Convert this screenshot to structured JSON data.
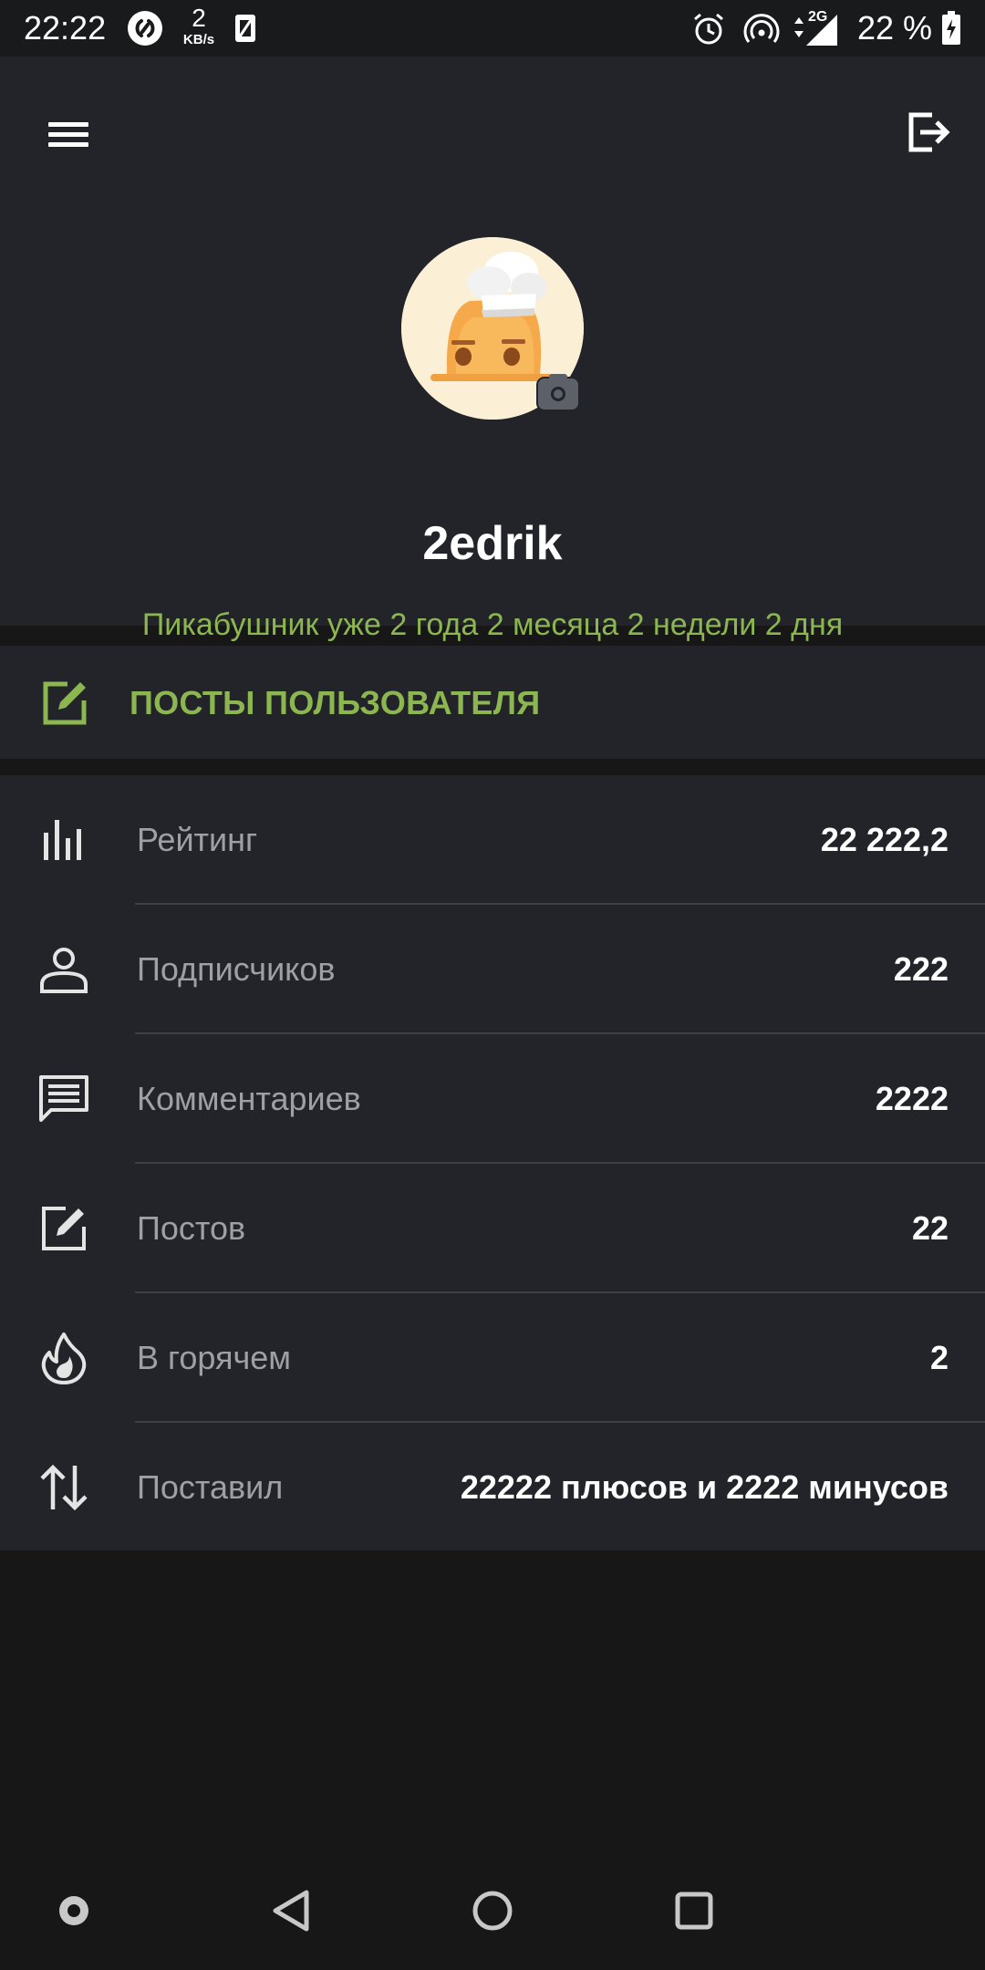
{
  "status_bar": {
    "time": "22:22",
    "speed_value": "2",
    "speed_unit": "KB/s",
    "network": "2G",
    "battery": "22 %"
  },
  "profile": {
    "username": "2edrik",
    "since": "Пикабушник уже 2 года 2 месяца 2 недели 2 дня"
  },
  "posts_section": {
    "label": "ПОСТЫ ПОЛЬЗОВАТЕЛЯ"
  },
  "stats": [
    {
      "label": "Рейтинг",
      "value": "22 222,2",
      "icon": "bar-chart-icon"
    },
    {
      "label": "Подписчиков",
      "value": "222",
      "icon": "person-icon"
    },
    {
      "label": "Комментариев",
      "value": "2222",
      "icon": "comment-icon"
    },
    {
      "label": "Постов",
      "value": "22",
      "icon": "edit-icon"
    },
    {
      "label": "В горячем",
      "value": "2",
      "icon": "flame-icon"
    },
    {
      "label": "Поставил",
      "value": "22222 плюсов и 2222 минусов",
      "icon": "sort-arrows-icon"
    }
  ],
  "colors": {
    "accent_green": "#8cb650",
    "panel": "#222429",
    "background": "#171718",
    "muted_text": "#9ea0a5"
  }
}
